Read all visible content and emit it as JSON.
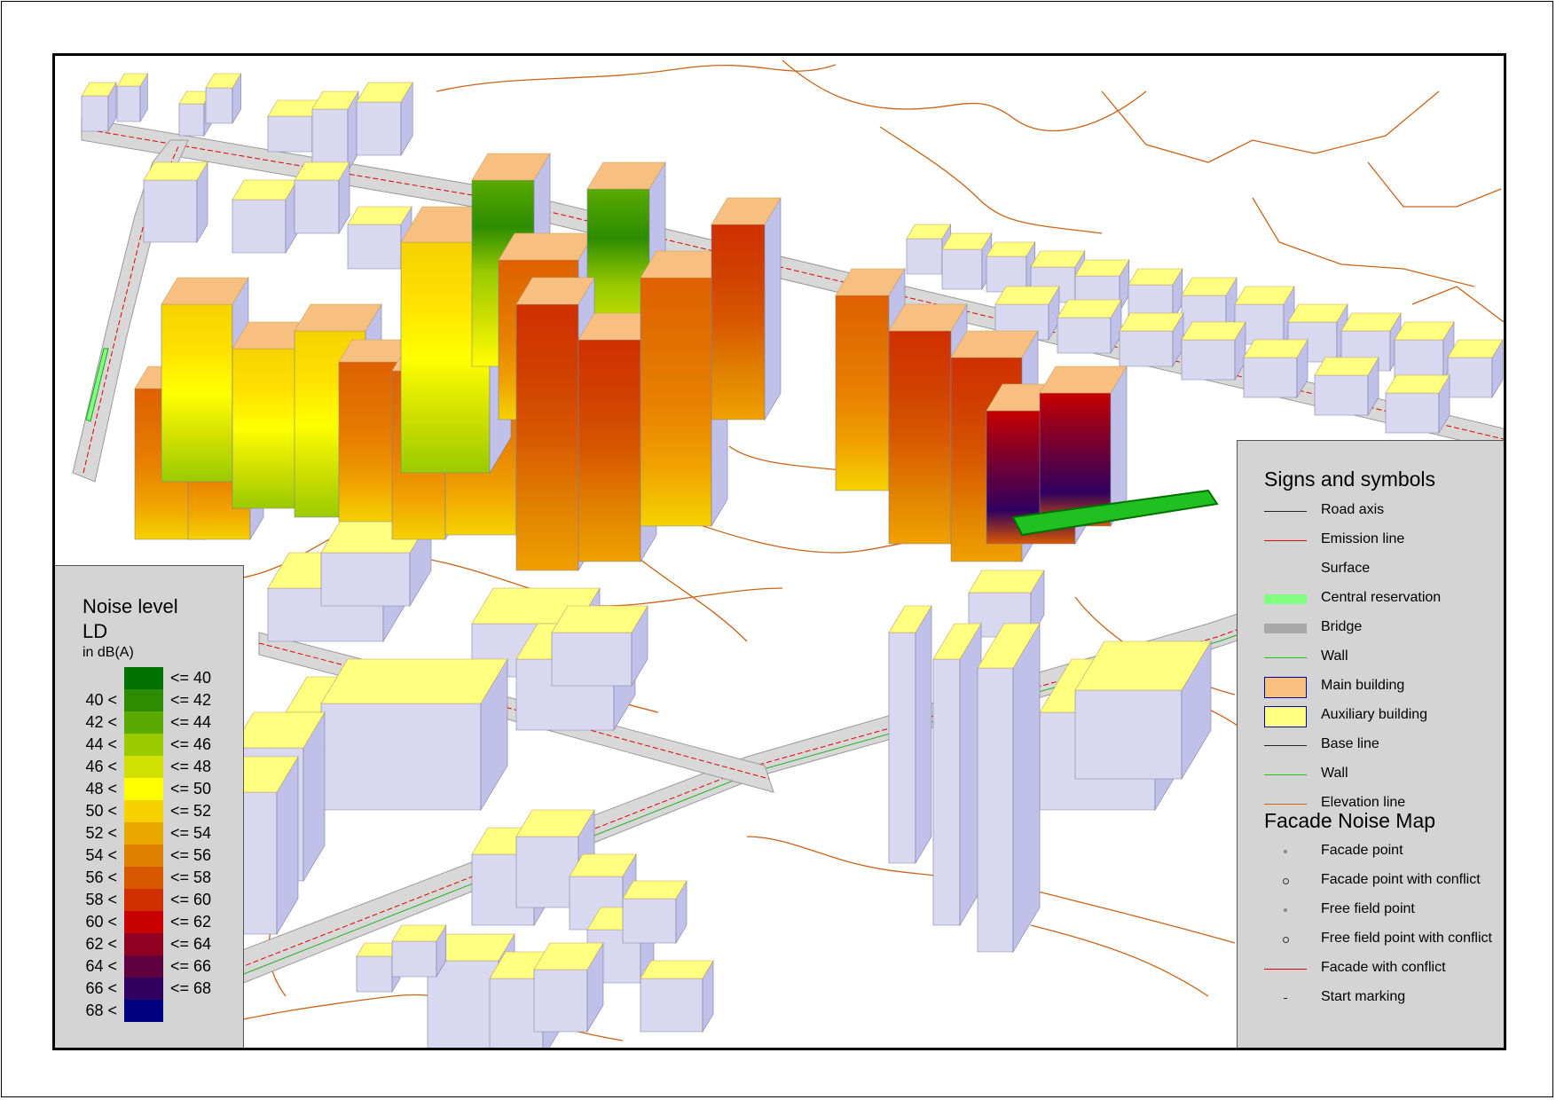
{
  "noise_legend": {
    "title_line1": "Noise level",
    "title_line2": "LD",
    "unit": "in dB(A)",
    "classes": [
      {
        "lower": "",
        "upper": "<= 40",
        "color": "#007000"
      },
      {
        "lower": "40 <",
        "upper": "<= 42",
        "color": "#2d8c00"
      },
      {
        "lower": "42 <",
        "upper": "<= 44",
        "color": "#5aab00"
      },
      {
        "lower": "44 <",
        "upper": "<= 46",
        "color": "#9acb00"
      },
      {
        "lower": "46 <",
        "upper": "<= 48",
        "color": "#d0e000"
      },
      {
        "lower": "48 <",
        "upper": "<= 50",
        "color": "#ffff00"
      },
      {
        "lower": "50 <",
        "upper": "<= 52",
        "color": "#f5d200"
      },
      {
        "lower": "52 <",
        "upper": "<= 54",
        "color": "#e8a800"
      },
      {
        "lower": "54 <",
        "upper": "<= 56",
        "color": "#e08000"
      },
      {
        "lower": "56 <",
        "upper": "<= 58",
        "color": "#d85800"
      },
      {
        "lower": "58 <",
        "upper": "<= 60",
        "color": "#d03000"
      },
      {
        "lower": "60 <",
        "upper": "<= 62",
        "color": "#c80000"
      },
      {
        "lower": "62 <",
        "upper": "<= 64",
        "color": "#900020"
      },
      {
        "lower": "64 <",
        "upper": "<= 66",
        "color": "#600040"
      },
      {
        "lower": "66 <",
        "upper": "<= 68",
        "color": "#300060"
      },
      {
        "lower": "68 <",
        "upper": "",
        "color": "#000080"
      }
    ]
  },
  "signs_legend": {
    "title": "Signs and symbols",
    "items": [
      {
        "label": "Road axis",
        "symbol": "line-black"
      },
      {
        "label": "Emission line",
        "symbol": "line-red"
      },
      {
        "label": "Surface",
        "symbol": "none"
      },
      {
        "label": "Central reservation",
        "symbol": "fill-green"
      },
      {
        "label": "Bridge",
        "symbol": "fill-gray"
      },
      {
        "label": "Wall",
        "symbol": "line-green"
      },
      {
        "label": "Main building",
        "symbol": "fill-orange"
      },
      {
        "label": "Auxiliary building",
        "symbol": "fill-yellow"
      },
      {
        "label": "Base line",
        "symbol": "line-black"
      },
      {
        "label": "Wall",
        "symbol": "line-green"
      },
      {
        "label": "Elevation line",
        "symbol": "line-brown"
      }
    ],
    "facade_title": "Facade Noise Map",
    "facade_items": [
      {
        "label": "Facade point",
        "symbol": "dot-small"
      },
      {
        "label": "Facade point with conflict",
        "symbol": "dot-ring"
      },
      {
        "label": "Free field point",
        "symbol": "dot-small"
      },
      {
        "label": "Free field point with conflict",
        "symbol": "dot-ring"
      },
      {
        "label": "Facade with conflict",
        "symbol": "line-red"
      },
      {
        "label": "Start marking",
        "symbol": "dash"
      }
    ]
  },
  "colors": {
    "main_building": "#f8c080",
    "auxiliary_building": "#ffff80",
    "building_side": "#c0c0e8",
    "building_dark": "#707088",
    "road": "#d0d0d0",
    "elevation_line": "#c86418",
    "emission_line": "#e00000",
    "central_reservation": "#80ff80"
  }
}
